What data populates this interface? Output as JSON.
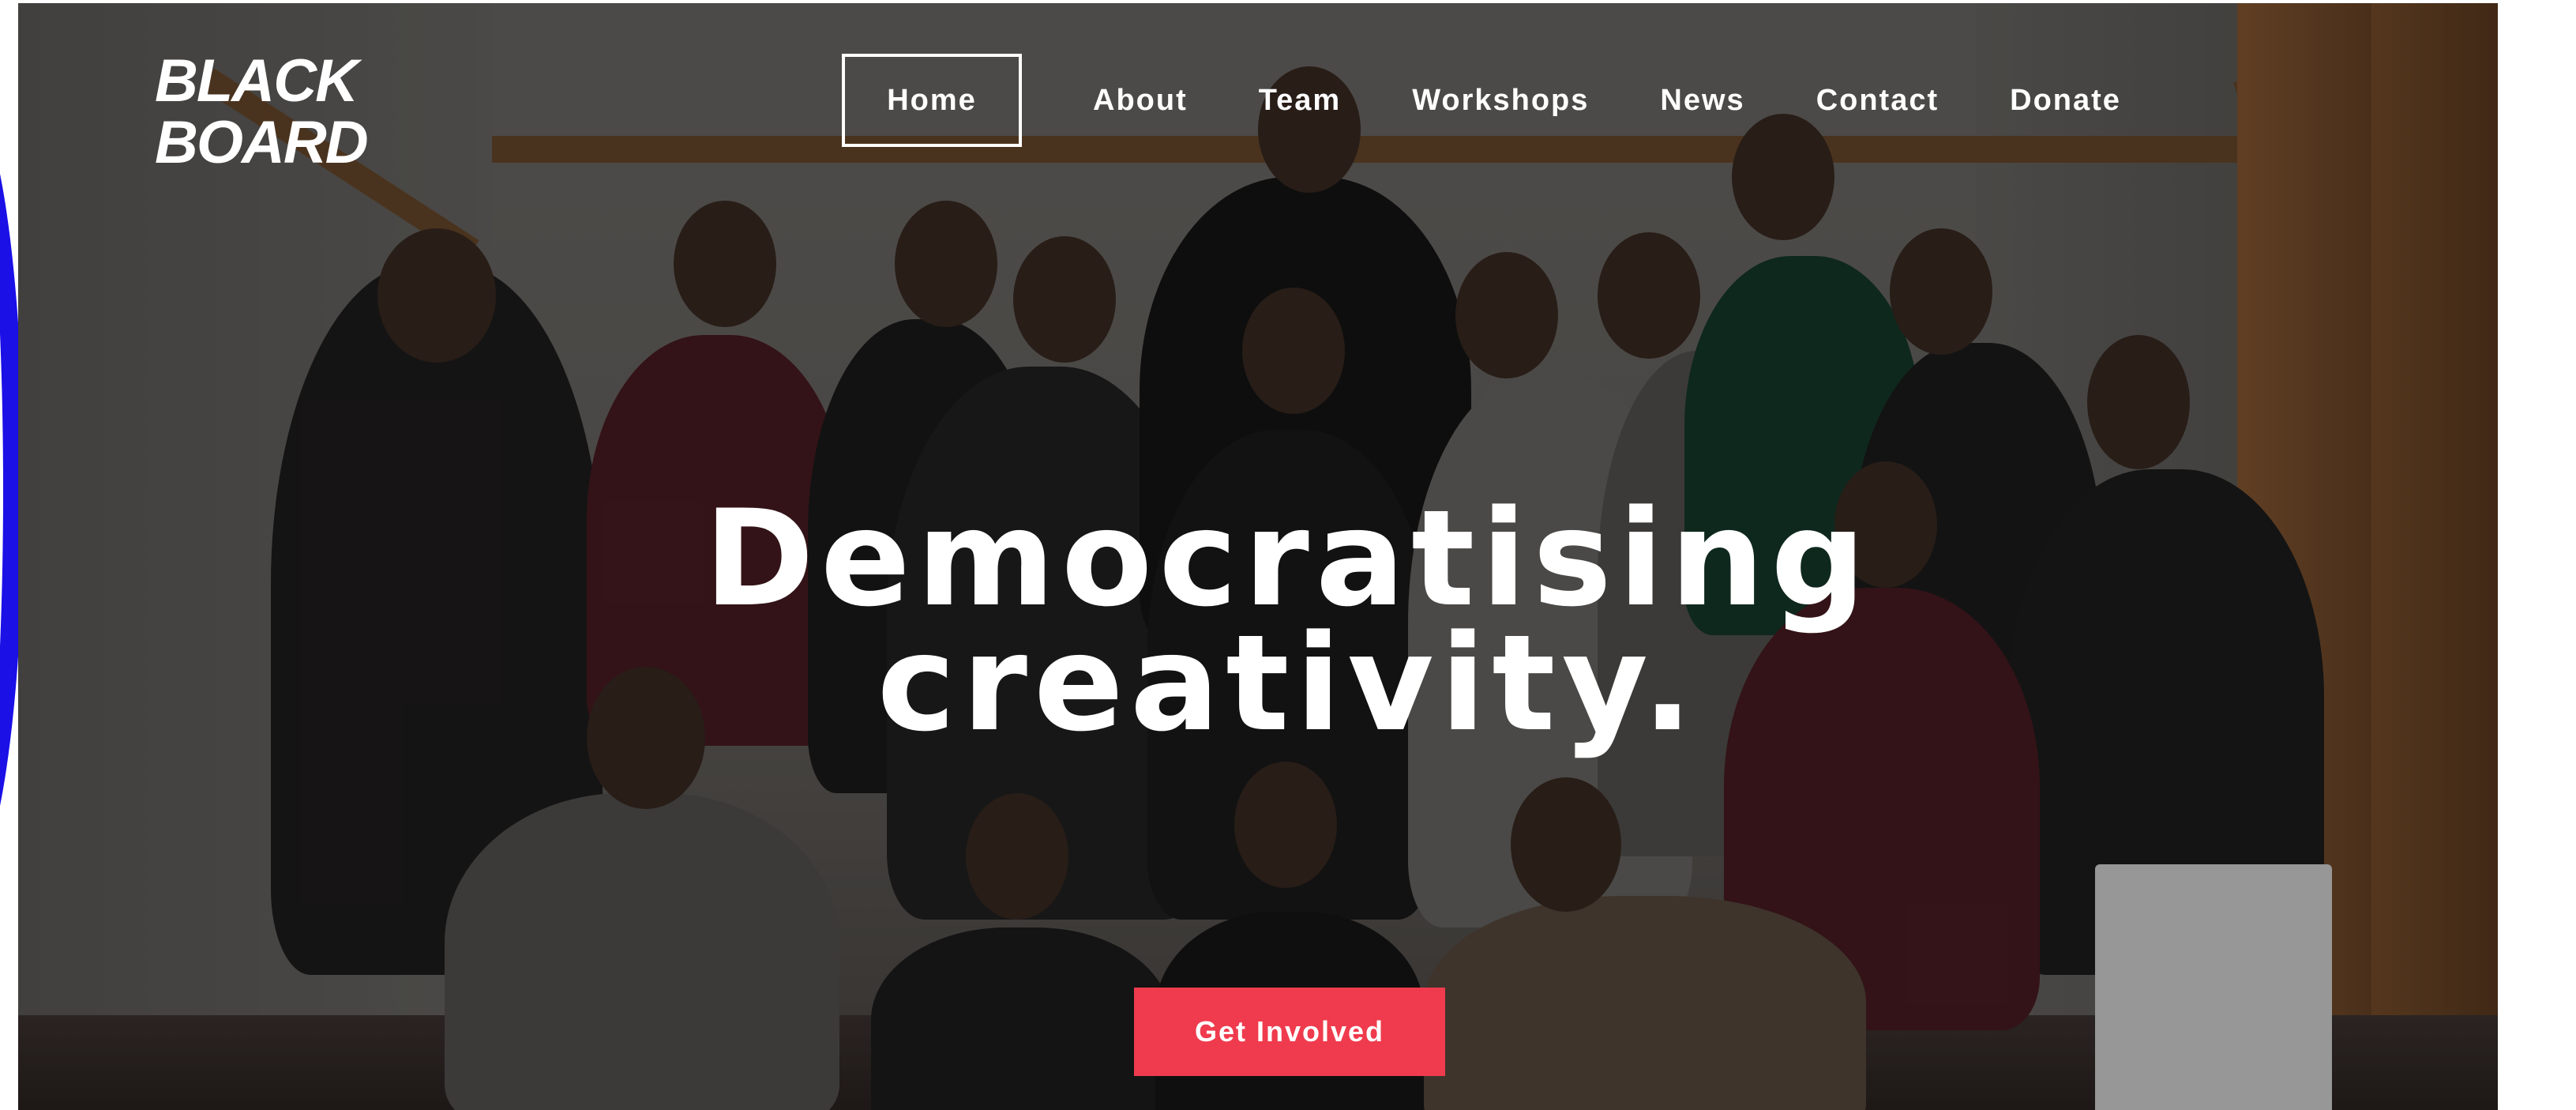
{
  "brand": {
    "line1": "BLACK",
    "line2": "BOARD"
  },
  "nav": {
    "items": [
      "Home",
      "About",
      "Team",
      "Workshops",
      "News",
      "Contact",
      "Donate"
    ],
    "active": "Home"
  },
  "hero": {
    "headline_line1": "Democratising",
    "headline_line2": "creativity.",
    "cta_label": "Get Involved"
  },
  "colors": {
    "accent": "#ef3b4d",
    "blue_arc": "#1b10e6",
    "text_on_image": "#ffffff"
  }
}
